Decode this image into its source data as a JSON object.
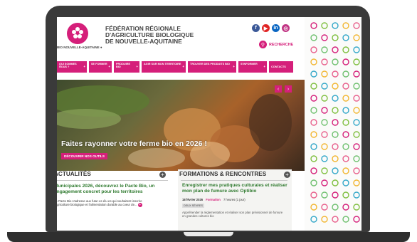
{
  "site": {
    "org_name": "FÉDÉRATION RÉGIONALE D'AGRICULTURE BIOLOGIQUE DE NOUVELLE-AQUITAINE",
    "logo_caption": "BIO NOUVELLE-AQUITAINE ●",
    "brand_color": "#d51f7a"
  },
  "social": [
    {
      "name": "facebook-icon",
      "glyph": "f",
      "color": "#3b5998"
    },
    {
      "name": "youtube-icon",
      "glyph": "▶",
      "color": "#e02424"
    },
    {
      "name": "linkedin-icon",
      "glyph": "in",
      "color": "#0a66c2"
    },
    {
      "name": "instagram-icon",
      "glyph": "◎",
      "color": "#c13584"
    }
  ],
  "search": {
    "label": "RECHERCHE",
    "icon": "search-icon"
  },
  "nav": [
    {
      "label": "QUI SOMMES NOUS ?",
      "plus": "+"
    },
    {
      "label": "SE FORMER",
      "plus": "+"
    },
    {
      "label": "PRODUIRE BIO",
      "plus": "+"
    },
    {
      "label": "AGIR SUR MON TERRITOIRE",
      "plus": "+"
    },
    {
      "label": "TROUVER DES PRODUITS BIO",
      "plus": "+"
    },
    {
      "label": "S'INFORMER",
      "plus": "+"
    },
    {
      "label": "CONTACTS",
      "plus": ""
    }
  ],
  "hero": {
    "title": "Faites rayonner votre ferme bio en 2026 !",
    "button": "DÉCOUVRIR NOS OUTILS",
    "prev": "‹",
    "next": "›"
  },
  "actualites": {
    "title": "ACTUALITÉS",
    "plus": "+",
    "article_title": "Municipales 2026, découvrez le Pacte Bio, un engagement concret pour les territoires",
    "article_text": "Le Pacte Bio s'adresse aux futur·es élu·es qui souhaitent inscrire l'agriculture biologique et l'alimentation durable au coeur de...",
    "more": "+"
  },
  "formations": {
    "title": "FORMATIONS & RENCONTRES",
    "plus": "+",
    "event_title": "Enregistrer mes pratiques culturales et réaliser mon plan de fumure avec Optibio",
    "date": "18 février 2026",
    "type": "Formation",
    "duration": "7 heures (1 jour)",
    "place": "DEUX SÈVRES",
    "description": "Appréhender la réglementation et réaliser son plan prévisionnel de fumure en grandes cultures bio"
  }
}
